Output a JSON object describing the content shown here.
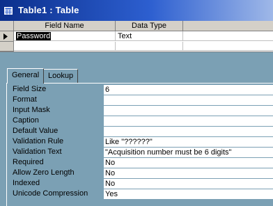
{
  "window": {
    "title": "Table1 : Table"
  },
  "grid": {
    "headers": [
      "Field Name",
      "Data Type"
    ],
    "rows": [
      {
        "field_name": "Password",
        "data_type": "Text"
      }
    ]
  },
  "tabs": [
    {
      "label": "General",
      "active": true
    },
    {
      "label": "Lookup",
      "active": false
    }
  ],
  "properties": [
    {
      "label": "Field Size",
      "value": "6"
    },
    {
      "label": "Format",
      "value": ""
    },
    {
      "label": "Input Mask",
      "value": ""
    },
    {
      "label": "Caption",
      "value": ""
    },
    {
      "label": "Default Value",
      "value": ""
    },
    {
      "label": "Validation Rule",
      "value": "Like \"??????\""
    },
    {
      "label": "Validation Text",
      "value": "\"Acquisition number must be 6 digits\""
    },
    {
      "label": "Required",
      "value": "No"
    },
    {
      "label": "Allow Zero Length",
      "value": "No"
    },
    {
      "label": "Indexed",
      "value": "No"
    },
    {
      "label": "Unicode Compression",
      "value": "Yes"
    }
  ],
  "colors": {
    "title_start": "#0b2f8c",
    "title_end": "#9fb8e8",
    "panel_bg": "#7ba0b4"
  }
}
